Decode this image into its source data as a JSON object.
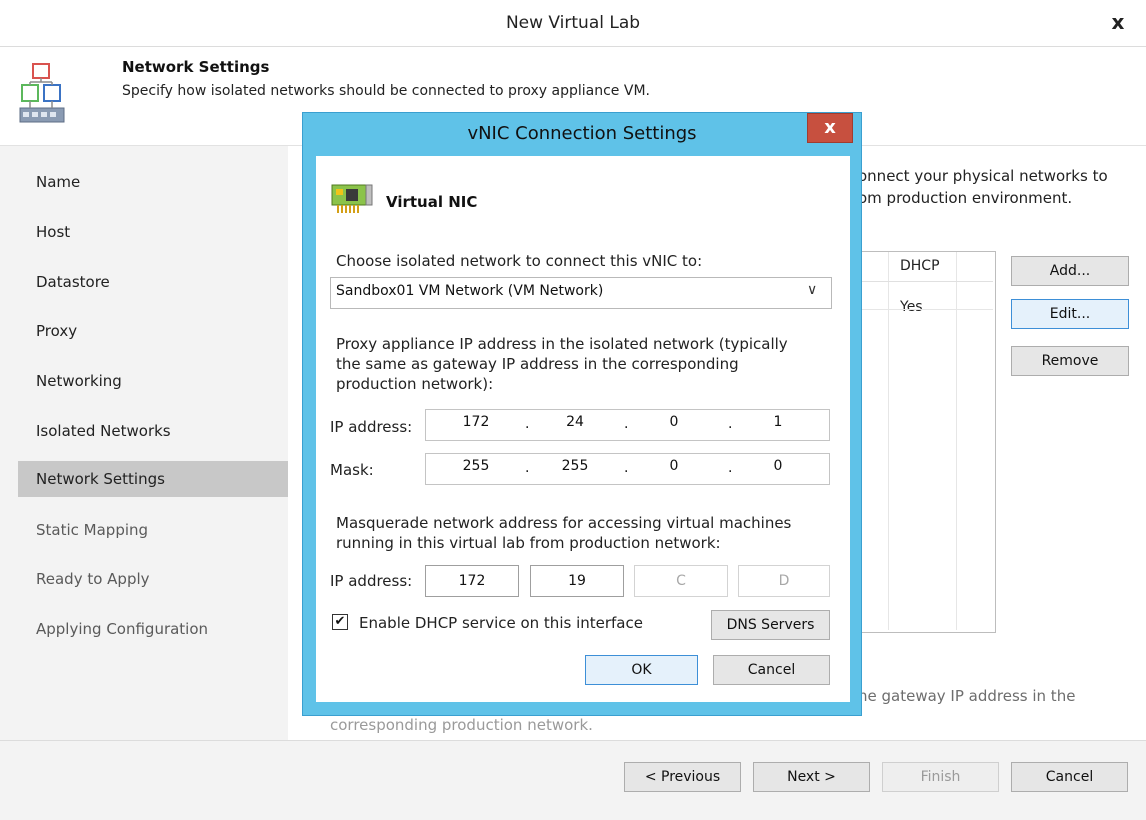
{
  "window": {
    "title": "New Virtual Lab",
    "close_glyph": "x"
  },
  "header": {
    "title": "Network Settings",
    "subtitle": "Specify how isolated networks should be connected to proxy appliance VM.",
    "icon": "network-settings-icon"
  },
  "sidebar": {
    "items": [
      {
        "label": "Name",
        "state": "done"
      },
      {
        "label": "Host",
        "state": "done"
      },
      {
        "label": "Datastore",
        "state": "done"
      },
      {
        "label": "Proxy",
        "state": "done"
      },
      {
        "label": "Networking",
        "state": "done"
      },
      {
        "label": "Isolated Networks",
        "state": "done"
      },
      {
        "label": "Network Settings",
        "state": "active"
      },
      {
        "label": "Static Mapping",
        "state": "pending"
      },
      {
        "label": "Ready to Apply",
        "state": "pending"
      },
      {
        "label": "Applying Configuration",
        "state": "pending"
      }
    ]
  },
  "background": {
    "desc_line1": "onnect your physical networks to",
    "desc_line2": "om production environment.",
    "table_header_dhcp": "DHCP",
    "table_cell_dhcp": "Yes",
    "add_button": "Add...",
    "edit_button": "Edit...",
    "remove_button": "Remove",
    "footnote": "he gateway IP address in the",
    "footnote2": "corresponding production network."
  },
  "footer": {
    "previous": "< Previous",
    "next": "Next >",
    "finish": "Finish",
    "cancel": "Cancel"
  },
  "dialog": {
    "title": "vNIC Connection Settings",
    "close_glyph": "x",
    "section_title": "Virtual NIC",
    "choose_label": "Choose isolated network to connect this vNIC to:",
    "network_selected": "Sandbox01 VM Network (VM Network)",
    "proxy_desc": "Proxy appliance IP address in the isolated network (typically the same as gateway IP address in the corresponding production network):",
    "ip_label": "IP address:",
    "ip_octets": [
      "172",
      "24",
      "0",
      "1"
    ],
    "mask_label": "Mask:",
    "mask_octets": [
      "255",
      "255",
      "0",
      "0"
    ],
    "masq_desc": "Masquerade network address for accessing virtual machines running in this virtual lab from production network:",
    "masq_ip_label": "IP address:",
    "masq_octets": [
      "172",
      "19",
      "C",
      "D"
    ],
    "dhcp_checked": true,
    "dhcp_label": "Enable DHCP service on this interface",
    "dns_button": "DNS Servers",
    "ok_button": "OK",
    "cancel_button": "Cancel"
  },
  "colors": {
    "modal_frame": "#5fc2e8",
    "close_red": "#c7503f",
    "active_nav": "#c8c8c8",
    "focus_blue": "#3d8fd7"
  }
}
